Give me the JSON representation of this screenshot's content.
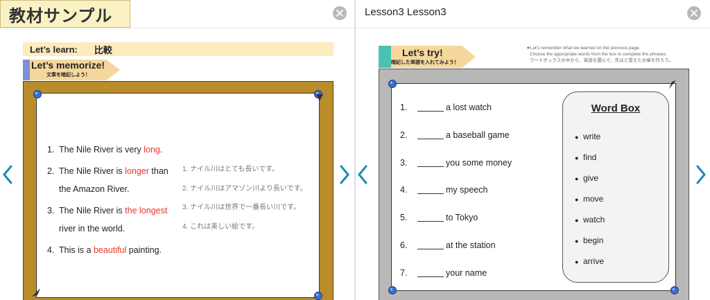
{
  "left_panel": {
    "sample_label": "教材サンプル",
    "learn_label": "Let’s learn:",
    "learn_topic": "比較",
    "memorize_title": "Let’s memorize!",
    "memorize_subtitle": "文章を暗記しよう！",
    "sentences": [
      {
        "num": "1.",
        "before": "The Nile River is very ",
        "highlight": "long",
        "after": "."
      },
      {
        "num": "2.",
        "before": "The Nile River is ",
        "highlight": "longer",
        "after": " than the Amazon River."
      },
      {
        "num": "3.",
        "before": "The Nile River is ",
        "highlight": "the longest",
        "after": " river in the world."
      },
      {
        "num": "4.",
        "before": "This is a ",
        "highlight": "beautiful",
        "after": " painting."
      }
    ],
    "japanese": [
      "1.  ナイル川はとても長いです。",
      "2.  ナイル川はアマゾン川より長いです。",
      "3.  ナイル川は世界で一番長い川です。",
      "4.  これは美しい絵です。"
    ]
  },
  "right_panel": {
    "title": "Lesson3 Lesson3",
    "try_title": "Let’s try!",
    "try_subtitle": "暗記した単語を入れてみよう！",
    "instructions": [
      "★Let's remember what we learned on the previous page.",
      "Choose the appropriate words from the box to complete the phrases.",
      "ワードボックスの中から、単語を選んで、先ほど覚えた文章を作ろう。"
    ],
    "questions": [
      {
        "num": "1.",
        "text": "a lost watch"
      },
      {
        "num": "2.",
        "text": "a baseball game"
      },
      {
        "num": "3.",
        "text": "you some money"
      },
      {
        "num": "4.",
        "text": "my speech"
      },
      {
        "num": "5.",
        "text": "to Tokyo"
      },
      {
        "num": "6.",
        "text": "at the station"
      },
      {
        "num": "7.",
        "text": "your name"
      }
    ],
    "word_box_title": "Word Box",
    "word_box": [
      "write",
      "find",
      "give",
      "move",
      "watch",
      "begin",
      "arrive"
    ]
  },
  "icons": {
    "close": "close-icon",
    "prev": "chevron-left-icon",
    "next": "chevron-right-icon"
  },
  "colors": {
    "accent_arrow": "#1a8ab8",
    "highlight_red": "#e8352b",
    "frame_gold": "#b98d2b",
    "frame_gray": "#b8b8b8",
    "pin_blue": "#3b6fd1"
  }
}
